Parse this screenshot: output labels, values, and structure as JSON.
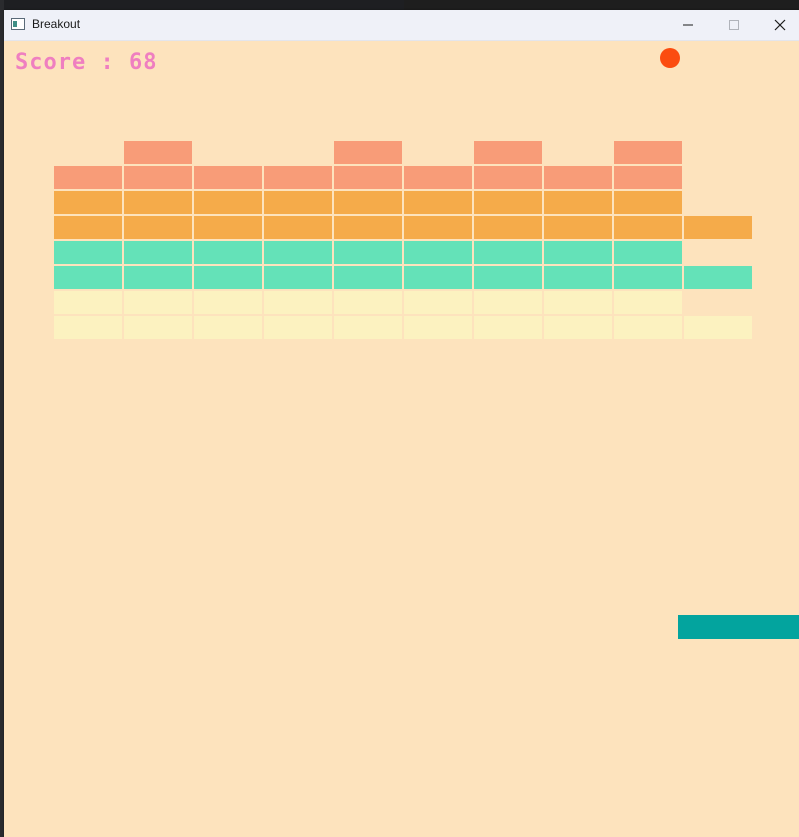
{
  "window": {
    "title": "Breakout"
  },
  "hud": {
    "score_text": "Score : 68"
  },
  "colors": {
    "background": "#fde3bd",
    "score": "#ef7fc0",
    "ball": "#fb4c10",
    "paddle": "#03a49e",
    "row_colors": [
      "#f89c78",
      "#f89c78",
      "#f5ab4a",
      "#f5ab4a",
      "#64e2b8",
      "#64e2b8",
      "#fcf2c0",
      "#fcf2c0"
    ]
  },
  "bricks": {
    "columns": 10,
    "rows": [
      [
        0,
        1,
        0,
        0,
        1,
        0,
        1,
        0,
        1,
        0
      ],
      [
        1,
        1,
        1,
        1,
        1,
        1,
        1,
        1,
        1,
        0
      ],
      [
        1,
        1,
        1,
        1,
        1,
        1,
        1,
        1,
        1,
        0
      ],
      [
        1,
        1,
        1,
        1,
        1,
        1,
        1,
        1,
        1,
        1
      ],
      [
        1,
        1,
        1,
        1,
        1,
        1,
        1,
        1,
        1,
        0
      ],
      [
        1,
        1,
        1,
        1,
        1,
        1,
        1,
        1,
        1,
        1
      ],
      [
        1,
        1,
        1,
        1,
        1,
        1,
        1,
        1,
        1,
        0
      ],
      [
        1,
        1,
        1,
        1,
        1,
        1,
        1,
        1,
        1,
        1
      ]
    ]
  }
}
